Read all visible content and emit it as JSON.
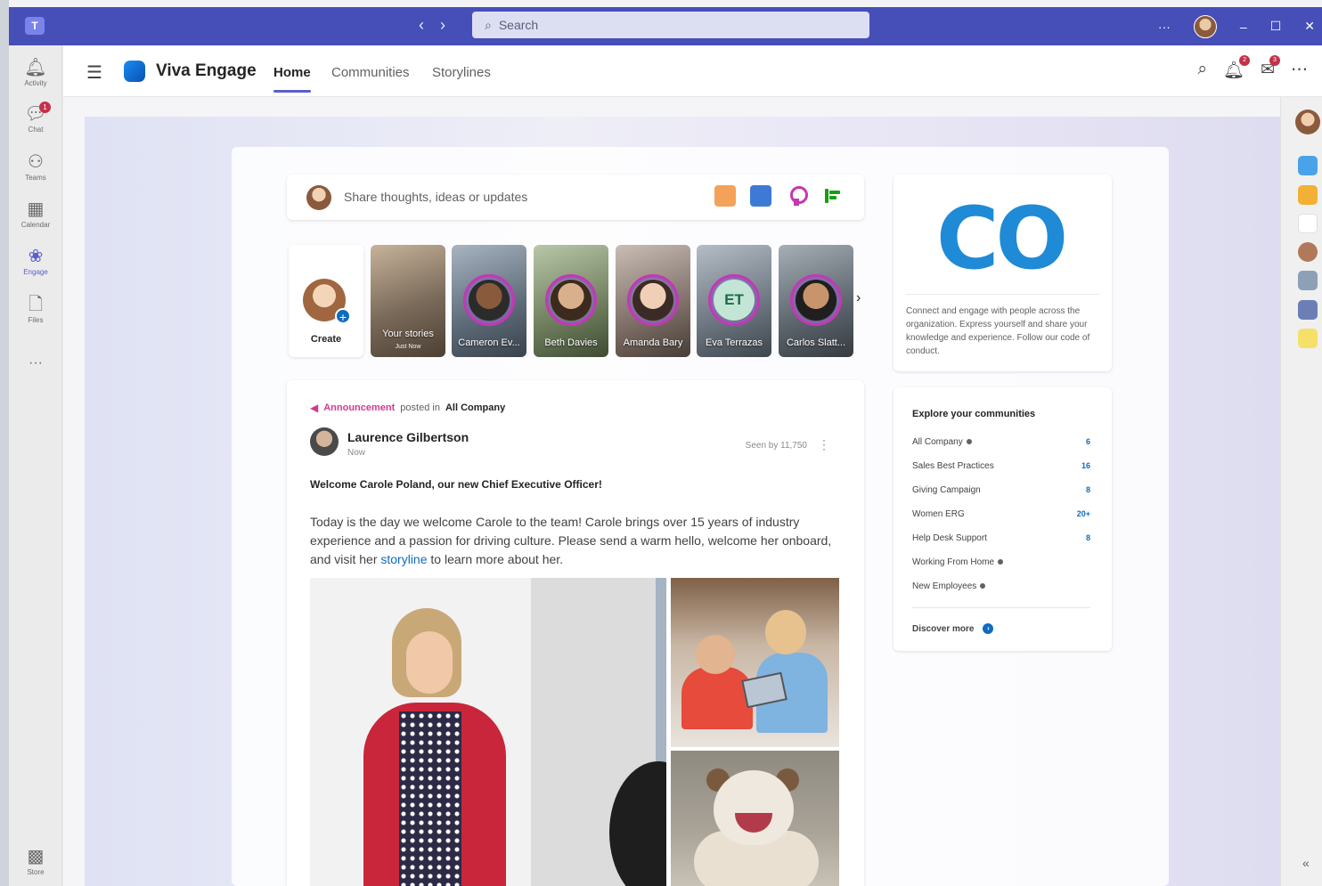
{
  "titlebar": {
    "search_placeholder": "Search",
    "more_label": "···",
    "minimize": "–",
    "maximize": "☐",
    "close": "✕"
  },
  "rail": {
    "items": [
      {
        "label": "Activity",
        "icon": "bell-icon"
      },
      {
        "label": "Chat",
        "icon": "chat-icon",
        "badge": "1"
      },
      {
        "label": "Teams",
        "icon": "teams-icon"
      },
      {
        "label": "Calendar",
        "icon": "calendar-icon"
      },
      {
        "label": "Engage",
        "icon": "engage-icon"
      },
      {
        "label": "Files",
        "icon": "files-icon"
      }
    ],
    "more": "···",
    "store": "Store"
  },
  "header": {
    "brand": "Viva Engage",
    "tabs": [
      "Home",
      "Communities",
      "Storylines"
    ],
    "notification_badge": "2",
    "inbox_badge": "3"
  },
  "composer": {
    "placeholder": "Share thoughts, ideas or updates"
  },
  "stories": {
    "create_label": "Create",
    "items": [
      {
        "name": "Your stories",
        "sub": "Just Now"
      },
      {
        "name": "Cameron Ev..."
      },
      {
        "name": "Beth Davies"
      },
      {
        "name": "Amanda Bary"
      },
      {
        "name": "Eva Terrazas",
        "initials": "ET"
      },
      {
        "name": "Carlos Slatt..."
      }
    ]
  },
  "post": {
    "type_label": "Announcement",
    "posted_in": "posted in",
    "community": "All Company",
    "author": "Laurence Gilbertson",
    "time": "Now",
    "seen": "Seen by 11,750",
    "headline": "Welcome Carole Poland, our new Chief Executive Officer!",
    "body_before": "Today is the day we welcome Carole to the team! Carole brings over 15 years of industry experience and a passion for driving culture. Please send a warm hello, welcome her onboard, and visit her ",
    "body_link": "storyline",
    "body_after": " to learn more about her."
  },
  "brand_card": {
    "logo": "CO",
    "description": "Connect and engage with people across the organization. Express yourself and share your knowledge and experience. Follow our code of conduct."
  },
  "communities": {
    "title": "Explore your communities",
    "items": [
      {
        "name": "All Company",
        "dot": true,
        "count": "6"
      },
      {
        "name": "Sales Best Practices",
        "dot": false,
        "count": "16"
      },
      {
        "name": "Giving Campaign",
        "dot": false,
        "count": "8"
      },
      {
        "name": "Women ERG",
        "dot": false,
        "count": "20+"
      },
      {
        "name": "Help Desk Support",
        "dot": false,
        "count": "8"
      },
      {
        "name": "Working From Home",
        "dot": true,
        "count": ""
      },
      {
        "name": "New Employees",
        "dot": true,
        "count": ""
      }
    ],
    "discover": "Discover more"
  },
  "colors": {
    "titlebar": "#464eb8",
    "accent": "#5b5fc7",
    "link": "#0f6cbd",
    "announcement": "#d2398e"
  }
}
